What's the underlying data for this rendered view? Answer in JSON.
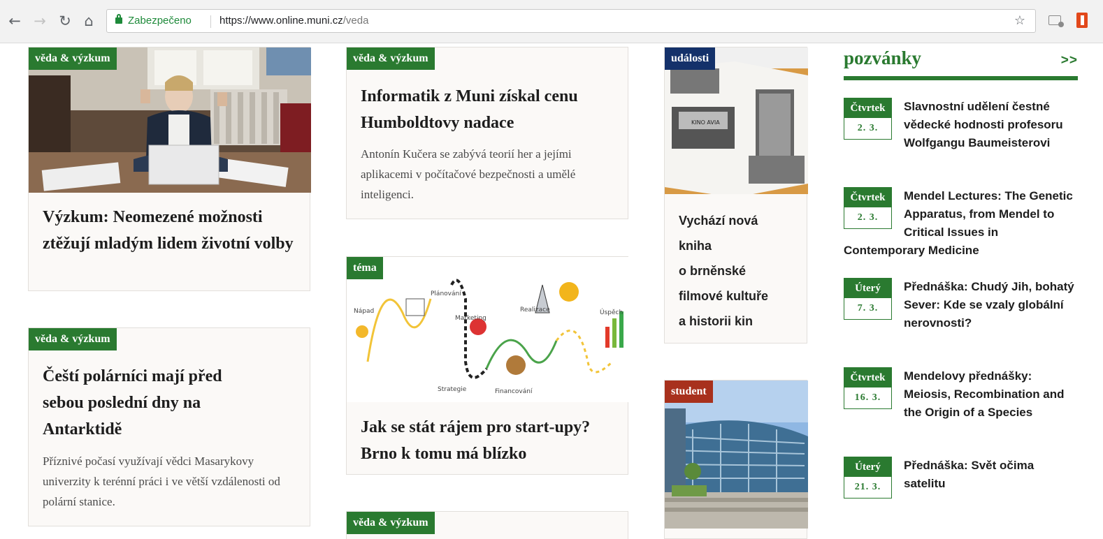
{
  "browser": {
    "back_icon": "←",
    "forward_icon": "→",
    "reload_icon": "↻",
    "home_icon": "⌂",
    "security_label": "Zabezpečeno",
    "url_host": "https://www.online.muni.cz",
    "url_path": "/veda",
    "star_icon": "☆"
  },
  "articles": {
    "a1": {
      "tag": "věda & výzkum",
      "title": "Výzkum: Neomezené možnosti ztěžují mladým lidem životní volby"
    },
    "a2": {
      "tag": "věda & výzkum",
      "title": "Čeští polárníci mají před sebou poslední dny na Antarktidě",
      "perex": "Příznivé počasí využívají vědci Masarykovy univerzity k terénní práci i ve větší vzdálenosti od polární stanice."
    },
    "a3": {
      "tag": "věda & výzkum",
      "title": "Informatik z Muni získal cenu Humboldtovy nadace",
      "perex": "Antonín Kučera se zabývá teorií her a jejími aplikacemi v počítačové bezpečnosti a umělé inteligenci."
    },
    "a4": {
      "tag": "téma",
      "title": "Jak se stát rájem pro start-upy? Brno k tomu má blízko",
      "illustration_labels": [
        "Nápad",
        "Plánování",
        "Marketing",
        "Realizace",
        "Úspěch",
        "Strategie",
        "Financování"
      ]
    },
    "a5": {
      "tag": "věda & výzkum"
    },
    "a6": {
      "tag": "události",
      "title_lines": [
        "Vychází nová",
        "kniha",
        "o brněnské",
        "filmové kultuře",
        "a historii kin"
      ],
      "photo_sign": "KINO AVIA"
    },
    "a7": {
      "tag": "student"
    }
  },
  "sidebar": {
    "heading": "pozvánky",
    "more": ">>",
    "events": [
      {
        "day": "Čtvrtek",
        "date": "2. 3.",
        "title": "Slavnostní udělení čestné vědecké hodnosti profesoru Wolfgangu Baumeisterovi"
      },
      {
        "day": "Čtvrtek",
        "date": "2. 3.",
        "title": "Mendel Lectures: The Genetic Apparatus, from Mendel to Critical Issues in Contemporary Medicine"
      },
      {
        "day": "Úterý",
        "date": "7. 3.",
        "title": "Přednáška: Chudý Jih, bohatý Sever: Kde se vzaly globální nerovnosti?"
      },
      {
        "day": "Čtvrtek",
        "date": "16. 3.",
        "title": "Mendelovy přednášky: Meiosis, Recombination and the Origin of a Species"
      },
      {
        "day": "Úterý",
        "date": "21. 3.",
        "title": "Přednáška: Svět očima satelitu"
      }
    ]
  },
  "colors": {
    "green": "#2a7a30",
    "blue": "#14316a",
    "red": "#a8311d"
  }
}
